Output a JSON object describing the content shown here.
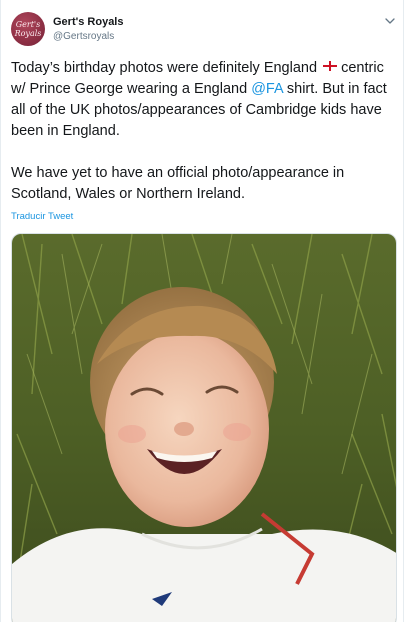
{
  "tweet": {
    "author_name": "Gert's Royals",
    "author_handle": "@Gertsroyals",
    "avatar_text_line1": "Gert's",
    "avatar_text_line2": "Royals",
    "text_part1": "Today’s birthday photos were definitely England ",
    "text_part2": " centric w/ Prince George wearing a England ",
    "mention": "@FA",
    "text_part3": " shirt. But in fact all of the UK photos/appearances of Cambridge kids have been in England.",
    "paragraph2": "We have yet to have an official photo/appearance in Scotland, Wales or Northern Ireland.",
    "translate_label": "Traducir Tweet",
    "flag_icon": "england-flag-icon",
    "menu_icon": "chevron-down-icon",
    "photo_subject": "photo of a laughing boy lying in grass wearing a white football shirt"
  },
  "colors": {
    "link": "#1b95e0",
    "avatar_bg": "#8d2f44",
    "flag_cross": "#ce1124"
  }
}
